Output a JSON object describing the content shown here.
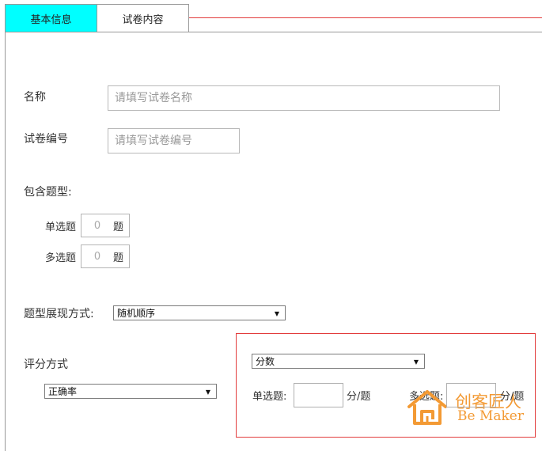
{
  "tabs": {
    "basic_info": "基本信息",
    "paper_content": "试卷内容"
  },
  "form": {
    "name_label": "名称",
    "name_placeholder": "请填写试卷名称",
    "number_label": "试卷编号",
    "number_placeholder": "请填写试卷编号",
    "question_types_label": "包含题型:",
    "single_choice_label": "单选题",
    "single_choice_count": "0",
    "multi_choice_label": "多选题",
    "multi_choice_count": "0",
    "unit_question": "题",
    "display_mode_label": "题型展现方式:",
    "display_mode_value": "随机顺序",
    "scoring_label": "评分方式",
    "scoring_value": "正确率"
  },
  "score_panel": {
    "mode_value": "分数",
    "single_label": "单选题:",
    "single_unit": "分/题",
    "multi_label": "多选题:",
    "multi_unit": "分/题"
  },
  "watermark": {
    "cn_text": "创客匠人",
    "en_text": "Be Maker"
  },
  "colors": {
    "active_tab": "#00ffff",
    "accent_red": "#e23c3c",
    "watermark_orange": "#f39a34"
  }
}
